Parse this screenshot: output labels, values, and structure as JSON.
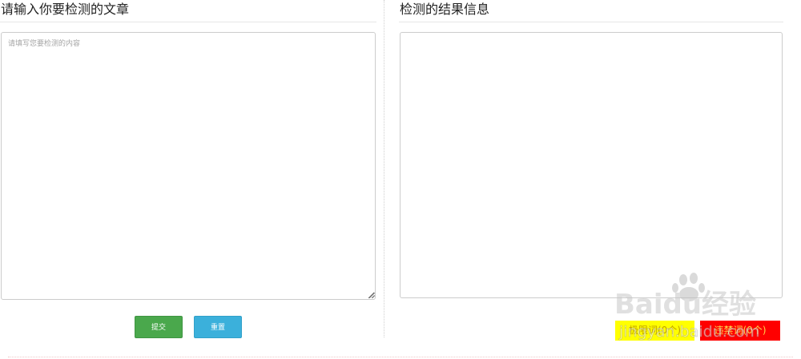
{
  "left_panel": {
    "title": "请输入你要检测的文章",
    "input_placeholder": "请填写您要检测的内容",
    "submit_label": "提交",
    "reset_label": "重置"
  },
  "right_panel": {
    "title": "检测的结果信息",
    "result_text": ""
  },
  "legend": {
    "yellow_label": "极限词(0个)",
    "red_label": "违禁词(0个)"
  },
  "watermark": {
    "brand_text": "Baidu经验",
    "url_text": "jingyan.baidu.com"
  },
  "colors": {
    "submit_button": "#4aa84c",
    "reset_button": "#3bb0db",
    "legend_yellow": "#ffff00",
    "legend_red": "#ff0000"
  }
}
